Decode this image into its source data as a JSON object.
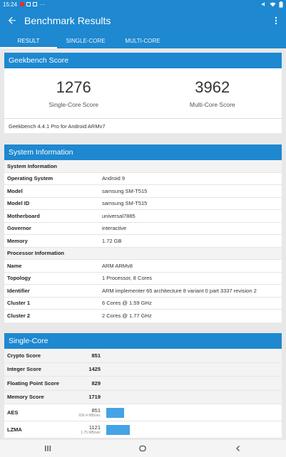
{
  "status": {
    "time": "15:24"
  },
  "appbar": {
    "title": "Benchmark Results"
  },
  "tabs": [
    {
      "label": "RESULT"
    },
    {
      "label": "SINGLE-CORE"
    },
    {
      "label": "MULTI-CORE"
    }
  ],
  "geekbench": {
    "heading": "Geekbench Score",
    "single_value": "1276",
    "single_label": "Single-Core Score",
    "multi_value": "3962",
    "multi_label": "Multi-Core Score",
    "version": "Geekbench 4.4.1 Pro for Android ARMv7"
  },
  "system": {
    "heading": "System Information",
    "sys_section": "System Information",
    "rows": [
      {
        "k": "Operating System",
        "v": "Android 9"
      },
      {
        "k": "Model",
        "v": "samsung SM-T515"
      },
      {
        "k": "Model ID",
        "v": "samsung SM-T515"
      },
      {
        "k": "Motherboard",
        "v": "universal7885"
      },
      {
        "k": "Governor",
        "v": "interactive"
      },
      {
        "k": "Memory",
        "v": "1.72 GB"
      }
    ],
    "proc_section": "Processor Information",
    "proc_rows": [
      {
        "k": "Name",
        "v": "ARM ARMv8"
      },
      {
        "k": "Topology",
        "v": "1 Processor, 8 Cores"
      },
      {
        "k": "Identifier",
        "v": "ARM implementer 65 architecture 8 variant 0 part 3337 revision 2"
      },
      {
        "k": "Cluster 1",
        "v": "6 Cores @ 1.59 GHz"
      },
      {
        "k": "Cluster 2",
        "v": "2 Cores @ 1.77 GHz"
      }
    ]
  },
  "single_core": {
    "heading": "Single-Core",
    "scores": [
      {
        "k": "Crypto Score",
        "v": "851"
      },
      {
        "k": "Integer Score",
        "v": "1425"
      },
      {
        "k": "Floating Point Score",
        "v": "829"
      },
      {
        "k": "Memory Score",
        "v": "1719"
      }
    ],
    "benchmarks": [
      {
        "k": "AES",
        "v": "851",
        "sub": "656.4 MB/sec",
        "value": 851
      },
      {
        "k": "LZMA",
        "v": "1121",
        "sub": "1.75 MB/sec",
        "value": 1121
      }
    ]
  },
  "colors": {
    "accent": "#1e88d0",
    "bar": "#44a3e6"
  }
}
